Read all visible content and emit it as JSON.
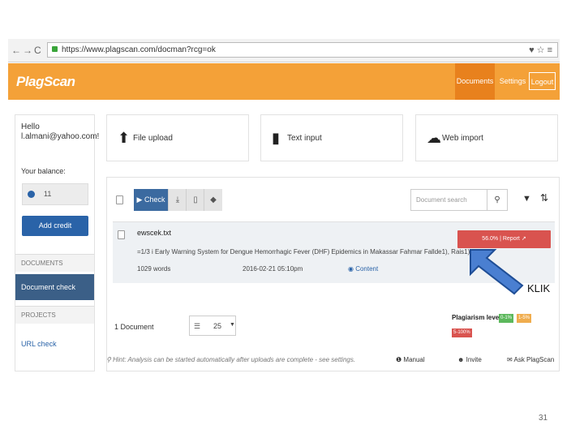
{
  "browser": {
    "nav": [
      "←",
      "→",
      "C"
    ],
    "url": "https://www.plagscan.com/docman?rcg=ok",
    "icons": "♥ ☆ ≡"
  },
  "header": {
    "logo": "PlagScan",
    "nav_documents": "Documents",
    "nav_settings": "Settings",
    "nav_logout": "Logout"
  },
  "sidebar": {
    "greeting_line1": "Hello",
    "greeting_line2": "l.almani@yahoo.com!",
    "balance_label": "Your balance:",
    "balance_value": "11",
    "add_credit": "Add credit",
    "section_documents": "DOCUMENTS",
    "document_check": "Document check",
    "section_projects": "PROJECTS",
    "url_check": "URL check"
  },
  "cards": [
    {
      "label": "File upload",
      "icon": "upload-icon",
      "glyph": "⬆"
    },
    {
      "label": "Text input",
      "icon": "text-file-icon",
      "glyph": "▮"
    },
    {
      "label": "Web import",
      "icon": "cloud-upload-icon",
      "glyph": "☁"
    }
  ],
  "toolbar": {
    "check_label": "Check",
    "search_placeholder": "Document search"
  },
  "document": {
    "name": "ewscek.txt",
    "title": "=1/3 i Early Warning System for Dengue Hemorrhagic Fever (DHF) Epidemics in Makassar Fahmar Fallde1), Rais1),",
    "words": "1029 words",
    "date": "2016-02-21 05:10pm",
    "content_link": "Content",
    "report_label": "56.0% | Report"
  },
  "summary": {
    "count": "1 Document",
    "per_page": "25",
    "plagiarism_label": "Plagiarism level",
    "levels": [
      {
        "text": "0-1%",
        "color": "#5cb85c"
      },
      {
        "text": "1-5%",
        "color": "#f0ad4e"
      },
      {
        "text": "5-100%",
        "color": "#d9534f"
      }
    ]
  },
  "footer": {
    "hint": "Hint: Analysis can be started automatically after uploads are complete - see settings.",
    "manual": "Manual",
    "invite": "Invite",
    "ask": "Ask PlagScan"
  },
  "annotation": {
    "klik": "KLIK",
    "arrow_color": "#4a7fd1"
  },
  "slide_number": "31"
}
